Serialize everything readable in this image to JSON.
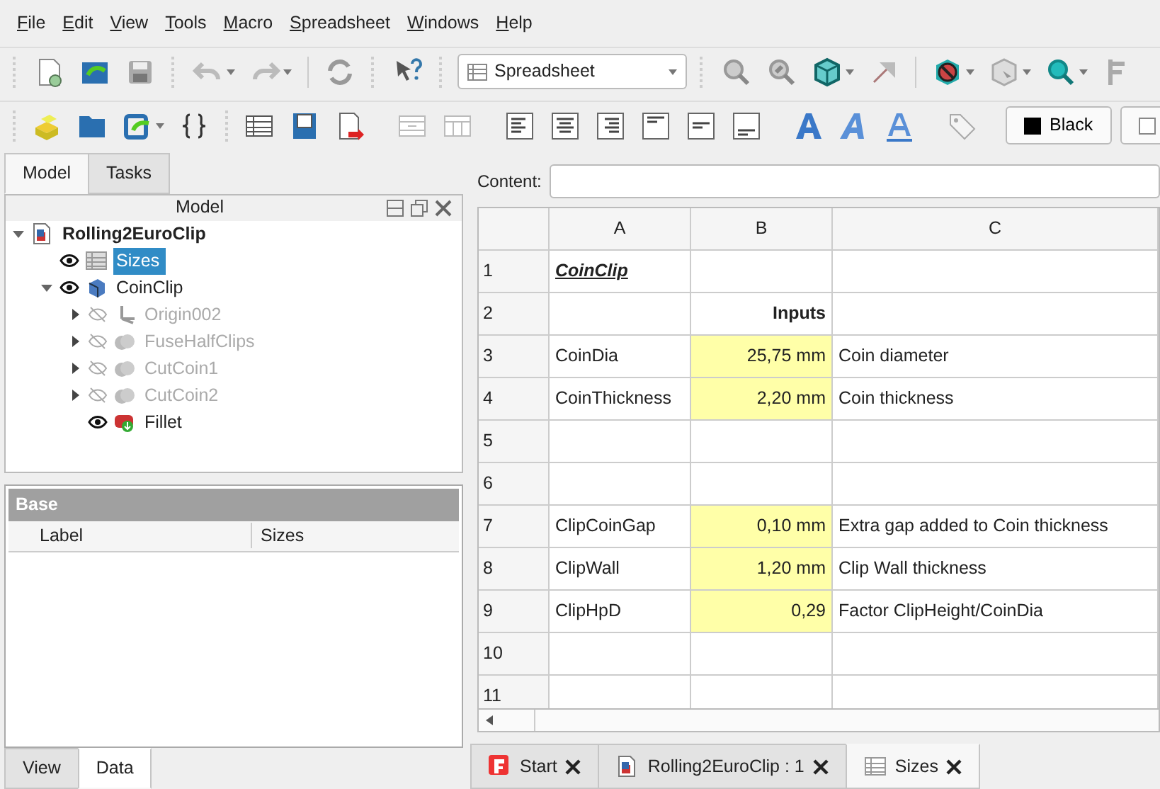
{
  "menu": [
    "File",
    "Edit",
    "View",
    "Tools",
    "Macro",
    "Spreadsheet",
    "Windows",
    "Help"
  ],
  "toolbar": {
    "workbench": "Spreadsheet",
    "text_color_button": "Black"
  },
  "left_tabs": [
    {
      "label": "Model",
      "selected": true
    },
    {
      "label": "Tasks",
      "selected": false
    }
  ],
  "tree_panel": {
    "title": "Model"
  },
  "tree": [
    {
      "label": "Rolling2EuroClip",
      "kind": "document",
      "expanded": true,
      "selected": false,
      "children": [
        {
          "label": "Sizes",
          "kind": "spreadsheet",
          "selected": true,
          "visible": true
        },
        {
          "label": "CoinClip",
          "kind": "body",
          "expanded": true,
          "selected": false,
          "visible": true,
          "children": [
            {
              "label": "Origin002",
              "kind": "origin",
              "expanded": false,
              "selected": false,
              "visible": false
            },
            {
              "label": "FuseHalfClips",
              "kind": "solid",
              "expanded": false,
              "selected": false,
              "visible": false
            },
            {
              "label": "CutCoin1",
              "kind": "solid",
              "expanded": false,
              "selected": false,
              "visible": false
            },
            {
              "label": "CutCoin2",
              "kind": "solid",
              "expanded": false,
              "selected": false,
              "visible": false
            },
            {
              "label": "Fillet",
              "kind": "fillet",
              "selected": false,
              "visible": true
            }
          ]
        }
      ]
    }
  ],
  "property_panel": {
    "group": "Base",
    "columns": [
      "Label",
      "Sizes"
    ]
  },
  "bottom_left_tabs": [
    {
      "label": "View",
      "selected": false
    },
    {
      "label": "Data",
      "selected": true
    }
  ],
  "content_label": "Content:",
  "sheet": {
    "columns": [
      "A",
      "B",
      "C"
    ],
    "rows": [
      {
        "header": "1",
        "cells": [
          {
            "text": "CoinClip",
            "kind": "title"
          },
          {
            "text": "",
            "kind": "text"
          },
          {
            "text": "",
            "kind": "text"
          }
        ]
      },
      {
        "header": "2",
        "cells": [
          {
            "text": "",
            "kind": "text"
          },
          {
            "text": "Inputs",
            "kind": "heading"
          },
          {
            "text": "",
            "kind": "text"
          }
        ]
      },
      {
        "header": "3",
        "cells": [
          {
            "text": "CoinDia",
            "kind": "text"
          },
          {
            "text": "25,75 mm",
            "kind": "input"
          },
          {
            "text": "Coin diameter",
            "kind": "text"
          }
        ]
      },
      {
        "header": "4",
        "cells": [
          {
            "text": "CoinThickness",
            "kind": "text"
          },
          {
            "text": "2,20 mm",
            "kind": "input"
          },
          {
            "text": "Coin thickness",
            "kind": "text"
          }
        ]
      },
      {
        "header": "5",
        "cells": [
          {
            "text": "",
            "kind": "text"
          },
          {
            "text": "",
            "kind": "text"
          },
          {
            "text": "",
            "kind": "text"
          }
        ]
      },
      {
        "header": "6",
        "cells": [
          {
            "text": "",
            "kind": "text"
          },
          {
            "text": "",
            "kind": "text"
          },
          {
            "text": "",
            "kind": "text"
          }
        ]
      },
      {
        "header": "7",
        "cells": [
          {
            "text": "ClipCoinGap",
            "kind": "text"
          },
          {
            "text": "0,10 mm",
            "kind": "input"
          },
          {
            "text": "Extra gap added to Coin thickness",
            "kind": "text"
          }
        ]
      },
      {
        "header": "8",
        "cells": [
          {
            "text": "ClipWall",
            "kind": "text"
          },
          {
            "text": "1,20 mm",
            "kind": "input"
          },
          {
            "text": "Clip Wall thickness",
            "kind": "text"
          }
        ]
      },
      {
        "header": "9",
        "cells": [
          {
            "text": "ClipHpD",
            "kind": "text"
          },
          {
            "text": "0,29",
            "kind": "input"
          },
          {
            "text": "Factor ClipHeight/CoinDia",
            "kind": "text"
          }
        ]
      },
      {
        "header": "10",
        "cells": [
          {
            "text": "",
            "kind": "text"
          },
          {
            "text": "",
            "kind": "text"
          },
          {
            "text": "",
            "kind": "text"
          }
        ]
      },
      {
        "header": "11",
        "cells": [
          {
            "text": "",
            "kind": "text"
          },
          {
            "text": "",
            "kind": "text"
          },
          {
            "text": "",
            "kind": "text"
          }
        ]
      }
    ]
  },
  "doc_tabs": [
    {
      "label": "Start",
      "kind": "start",
      "selected": false
    },
    {
      "label": "Rolling2EuroClip : 1",
      "kind": "document",
      "selected": false
    },
    {
      "label": "Sizes",
      "kind": "spreadsheet",
      "selected": true
    }
  ]
}
